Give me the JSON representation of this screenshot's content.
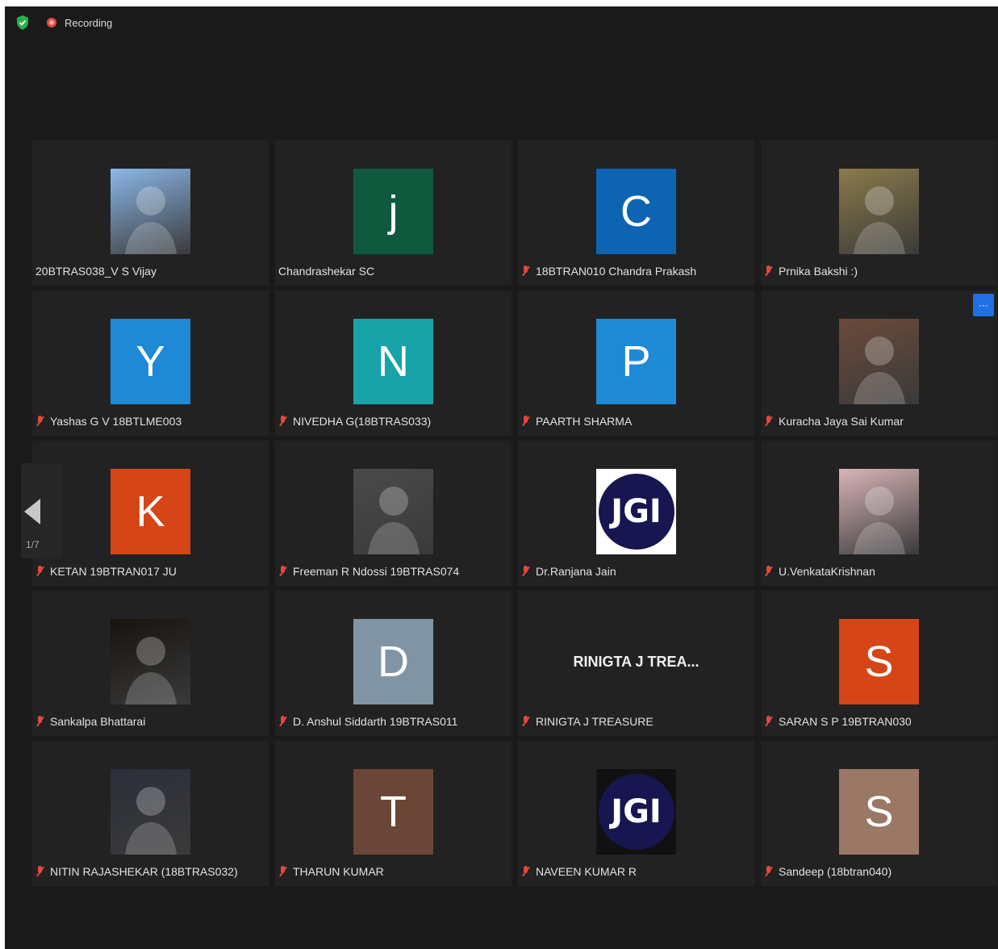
{
  "status": {
    "recording_label": "Recording"
  },
  "pager": {
    "page_indicator": "1/7"
  },
  "more_button": {
    "label": "···"
  },
  "colors": {
    "background": "#1a1a1a",
    "tile": "#222222",
    "muted_icon": "#e5483a",
    "accent": "#1f6fe5"
  },
  "participants": [
    {
      "name": "20BTRAS038_V S Vijay",
      "muted": false,
      "avatar_type": "photo",
      "initial": "",
      "color": "#8bb7e8"
    },
    {
      "name": "Chandrashekar SC",
      "muted": false,
      "avatar_type": "initial",
      "initial": "j",
      "color": "#0f5a3f"
    },
    {
      "name": "18BTRAN010 Chandra Prakash",
      "muted": true,
      "avatar_type": "initial",
      "initial": "C",
      "color": "#0c64b3"
    },
    {
      "name": "Prnika Bakshi :)",
      "muted": true,
      "avatar_type": "photo",
      "initial": "",
      "color": "#8b7a4a"
    },
    {
      "name": "Yashas G V 18BTLME003",
      "muted": true,
      "avatar_type": "initial",
      "initial": "Y",
      "color": "#1e8ad6"
    },
    {
      "name": "NIVEDHA G(18BTRAS033)",
      "muted": true,
      "avatar_type": "initial",
      "initial": "N",
      "color": "#17a3a8"
    },
    {
      "name": "PAARTH SHARMA",
      "muted": true,
      "avatar_type": "initial",
      "initial": "P",
      "color": "#1e8ad6"
    },
    {
      "name": "Kuracha Jaya Sai Kumar",
      "muted": true,
      "avatar_type": "photo",
      "initial": "",
      "color": "#6b4a3a"
    },
    {
      "name": "KETAN 19BTRAN017 JU",
      "muted": true,
      "avatar_type": "initial",
      "initial": "K",
      "color": "#d64516"
    },
    {
      "name": "Freeman R Ndossi 19BTRAS074",
      "muted": true,
      "avatar_type": "photo",
      "initial": "",
      "color": "#4a4a4a"
    },
    {
      "name": "Dr.Ranjana Jain",
      "muted": true,
      "avatar_type": "logo",
      "initial": "JGI",
      "color": "#ffffff"
    },
    {
      "name": "U.VenkataKrishnan",
      "muted": true,
      "avatar_type": "photo",
      "initial": "",
      "color": "#d9b4b8"
    },
    {
      "name": "Sankalpa Bhattarai",
      "muted": true,
      "avatar_type": "photo",
      "initial": "",
      "color": "#17130f"
    },
    {
      "name": "D. Anshul Siddarth 19BTRAS011",
      "muted": true,
      "avatar_type": "initial",
      "initial": "D",
      "color": "#8194a3"
    },
    {
      "name": "RINIGTA J TREASURE",
      "muted": true,
      "avatar_type": "text",
      "initial": "RINIGTA J TREA...",
      "color": ""
    },
    {
      "name": "SARAN S P 19BTRAN030",
      "muted": true,
      "avatar_type": "initial",
      "initial": "S",
      "color": "#d64516"
    },
    {
      "name": "NITIN RAJASHEKAR (18BTRAS032)",
      "muted": true,
      "avatar_type": "photo",
      "initial": "",
      "color": "#2c2f3a"
    },
    {
      "name": "THARUN KUMAR",
      "muted": true,
      "avatar_type": "initial",
      "initial": "T",
      "color": "#6b4537"
    },
    {
      "name": "NAVEEN KUMAR R",
      "muted": true,
      "avatar_type": "logo",
      "initial": "JGI",
      "color": "#111111"
    },
    {
      "name": "Sandeep (18btran040)",
      "muted": true,
      "avatar_type": "initial",
      "initial": "S",
      "color": "#9b7765"
    }
  ]
}
